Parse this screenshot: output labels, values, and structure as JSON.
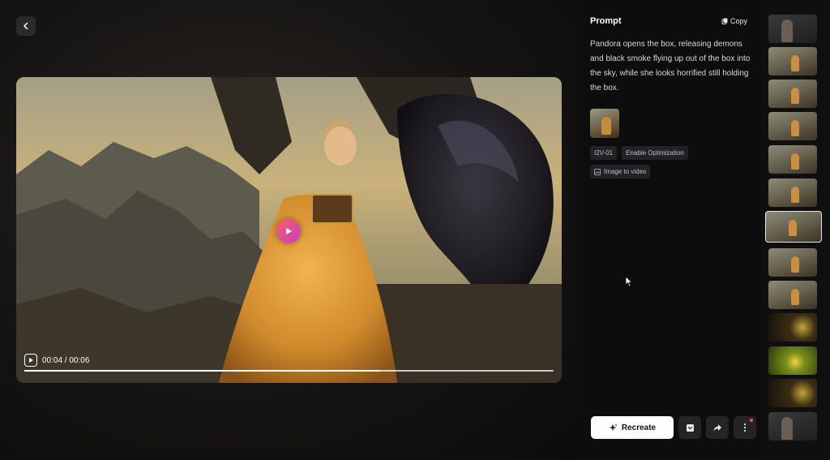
{
  "prompt_panel": {
    "title": "Prompt",
    "copy_label": "Copy",
    "text": "Pandora opens the box, releasing demons and black smoke flying up out of the box into the sky, while she looks horrified still holding the box.",
    "tags": [
      "I2V-01",
      "Enable Optimization"
    ],
    "mode_tag": "Image to video"
  },
  "player": {
    "time": "00:04 / 00:06",
    "progress": 0.67
  },
  "actions": {
    "recreate_label": "Recreate"
  },
  "colors": {
    "accent_play": "#ff5e62",
    "primary_button": "#ffffff",
    "background": "#0f0f10"
  },
  "icons": [
    "chevron-left-icon",
    "play-icon",
    "copy-icon",
    "image-icon",
    "sparkle-icon",
    "download-icon",
    "share-icon",
    "more-icon",
    "cursor-icon"
  ]
}
